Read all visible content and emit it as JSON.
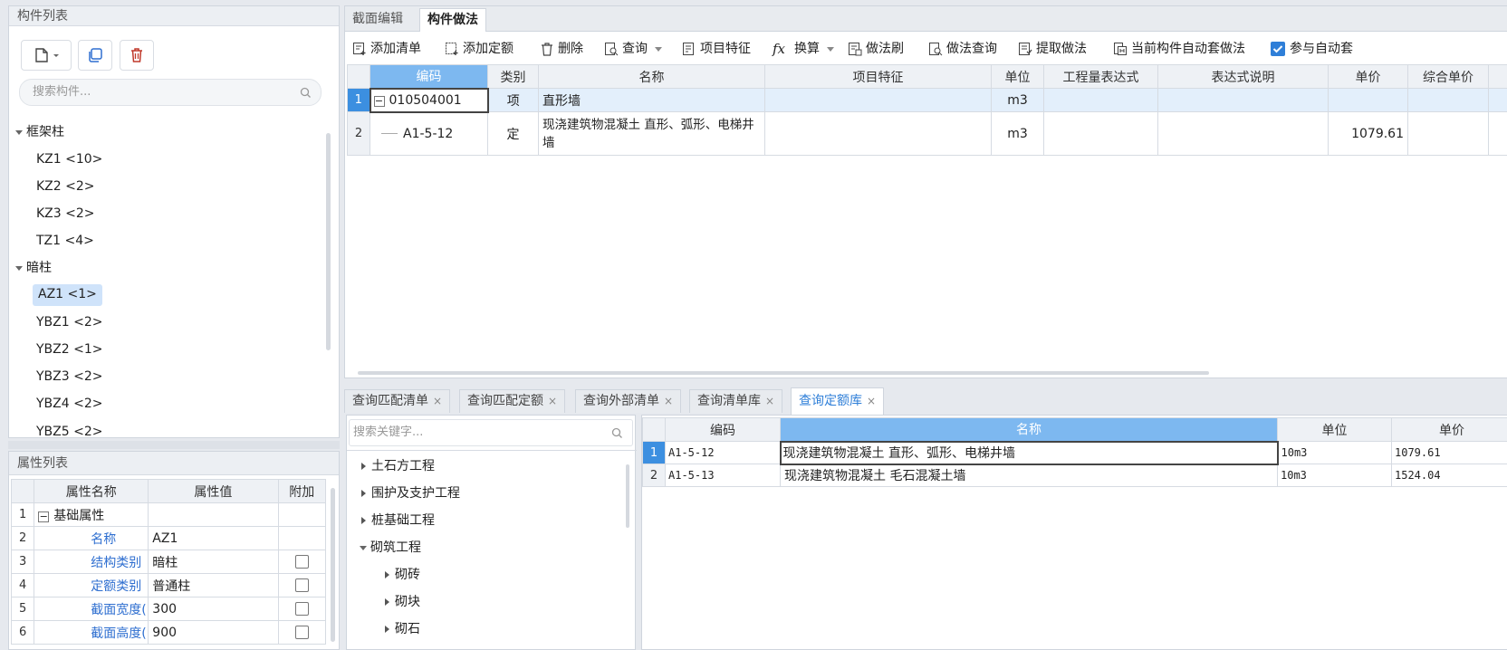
{
  "component_list": {
    "title": "构件列表",
    "search_placeholder": "搜索构件...",
    "groups": [
      {
        "label": "框架柱",
        "items": [
          "KZ1 <10>",
          "KZ2 <2>",
          "KZ3 <2>",
          "TZ1 <4>"
        ]
      },
      {
        "label": "暗柱",
        "items": [
          "AZ1 <1>",
          "YBZ1 <2>",
          "YBZ2 <1>",
          "YBZ3 <2>",
          "YBZ4 <2>",
          "YBZ5 <2>"
        ]
      }
    ]
  },
  "property_list": {
    "title": "属性列表",
    "headers": [
      "属性名称",
      "属性值",
      "附加"
    ],
    "rows": [
      {
        "num": "1",
        "name": "基础属性",
        "value": ""
      },
      {
        "num": "2",
        "name": "名称",
        "value": "AZ1"
      },
      {
        "num": "3",
        "name": "结构类别",
        "value": "暗柱"
      },
      {
        "num": "4",
        "name": "定额类别",
        "value": "普通柱"
      },
      {
        "num": "5",
        "name": "截面宽度(...",
        "value": "300"
      },
      {
        "num": "6",
        "name": "截面高度(...",
        "value": "900"
      }
    ]
  },
  "top_tabs": [
    "截面编辑",
    "构件做法"
  ],
  "toolbar": {
    "add_list": "添加清单",
    "add_quota": "添加定额",
    "delete": "删除",
    "query": "查询",
    "item_feature": "项目特征",
    "convert": "换算",
    "method_brush": "做法刷",
    "method_query": "做法查询",
    "extract_method": "提取做法",
    "auto_apply": "当前构件自动套做法",
    "participate_auto": "参与自动套"
  },
  "method_grid": {
    "headers": [
      "编码",
      "类别",
      "名称",
      "项目特征",
      "单位",
      "工程量表达式",
      "表达式说明",
      "单价",
      "综合单价"
    ],
    "rows": [
      {
        "num": "1",
        "code": "010504001",
        "type": "项",
        "name": "直形墙",
        "unit": "m3",
        "price": ""
      },
      {
        "num": "2",
        "code": "A1-5-12",
        "type": "定",
        "name": "现浇建筑物混凝土 直形、弧形、电梯井墙",
        "unit": "m3",
        "price": "1079.61"
      }
    ]
  },
  "bottom_tabs": [
    "查询匹配清单",
    "查询匹配定额",
    "查询外部清单",
    "查询清单库",
    "查询定额库"
  ],
  "quota_search_placeholder": "搜索关键字...",
  "quota_tree": [
    "土石方工程",
    "围护及支护工程",
    "桩基础工程",
    "砌筑工程",
    "砌砖",
    "砌块",
    "砌石"
  ],
  "quota_grid": {
    "headers": [
      "编码",
      "名称",
      "单位",
      "单价"
    ],
    "rows": [
      {
        "num": "1",
        "code": "A1-5-12",
        "name": "现浇建筑物混凝土 直形、弧形、电梯井墙",
        "unit": "10m3",
        "price": "1079.61"
      },
      {
        "num": "2",
        "code": "A1-5-13",
        "name": "现浇建筑物混凝土 毛石混凝土墙",
        "unit": "10m3",
        "price": "1524.04"
      }
    ]
  }
}
